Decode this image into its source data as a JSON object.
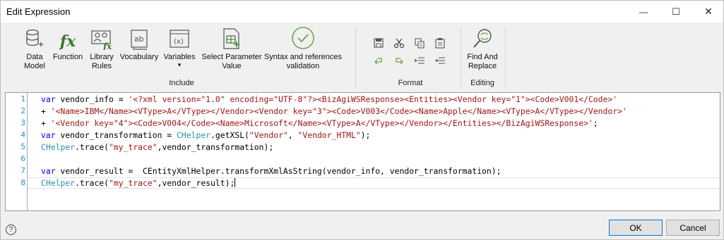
{
  "window": {
    "title": "Edit Expression",
    "minimize_glyph": "—",
    "maximize_glyph": "☐",
    "close_glyph": "✕"
  },
  "ribbon": {
    "include": {
      "label": "Include",
      "tools": [
        {
          "name": "data-model",
          "label": "Data\nModel",
          "icon": "database-add-icon"
        },
        {
          "name": "function",
          "label": "Function",
          "icon": "fx-icon",
          "glyph": "fx"
        },
        {
          "name": "library-rules",
          "label": "Library\nRules",
          "icon": "library-rules-icon"
        },
        {
          "name": "vocabulary",
          "label": "Vocabulary",
          "icon": "vocabulary-book-icon",
          "glyph": "ab"
        },
        {
          "name": "variables",
          "label": "Variables",
          "icon": "variables-icon",
          "glyph": "(x)",
          "dropdown": "▾"
        },
        {
          "name": "select-parameter-value",
          "label": "Select Parameter\nValue",
          "icon": "parameter-table-icon"
        },
        {
          "name": "syntax-validation",
          "label": "Syntax and references\nvalidation",
          "icon": "check-circle-icon"
        }
      ]
    },
    "format": {
      "label": "Format",
      "tools": [
        {
          "name": "save",
          "icon": "save-icon"
        },
        {
          "name": "cut",
          "icon": "cut-icon"
        },
        {
          "name": "copy",
          "icon": "copy-icon"
        },
        {
          "name": "paste",
          "icon": "paste-icon"
        },
        {
          "name": "undo",
          "icon": "undo-icon"
        },
        {
          "name": "redo",
          "icon": "redo-icon"
        },
        {
          "name": "outdent",
          "icon": "outdent-icon"
        },
        {
          "name": "indent",
          "icon": "indent-icon"
        }
      ]
    },
    "editing": {
      "label": "Editing",
      "tools": [
        {
          "name": "find-replace",
          "label": "Find And\nReplace",
          "icon": "find-replace-icon"
        }
      ]
    }
  },
  "editor": {
    "lines": [
      {
        "num": "1",
        "parts": [
          [
            "kw",
            "var"
          ],
          [
            "pl",
            " vendor_info = "
          ],
          [
            "str",
            "'<?xml version=\"1.0\" encoding=\"UTF-8\"?><BizAgiWSResponse><Entities><Vendor key=\"1\"><Code>V001</Code>'"
          ]
        ]
      },
      {
        "num": "2",
        "parts": [
          [
            "pl",
            "+ "
          ],
          [
            "str",
            "'<Name>IBM</Name><VType>A</VType></Vendor><Vendor key=\"3\"><Code>V003</Code><Name>Apple</Name><VType>A</VType></Vendor>'"
          ]
        ]
      },
      {
        "num": "3",
        "parts": [
          [
            "pl",
            "+ "
          ],
          [
            "str",
            "'<Vendor key=\"4\"><Code>V004</Code><Name>Microsoft</Name><VType>A</VType></Vendor></Entities></BizAgiWSResponse>'"
          ],
          [
            "pl",
            ";"
          ]
        ]
      },
      {
        "num": "4",
        "parts": [
          [
            "kw",
            "var"
          ],
          [
            "pl",
            " vendor_transformation = "
          ],
          [
            "cls",
            "CHelper"
          ],
          [
            "pl",
            ".getXSL("
          ],
          [
            "str",
            "\"Vendor\""
          ],
          [
            "pl",
            ", "
          ],
          [
            "str",
            "\"Vendor_HTML\""
          ],
          [
            "pl",
            ");"
          ]
        ]
      },
      {
        "num": "5",
        "parts": [
          [
            "cls",
            "CHelper"
          ],
          [
            "pl",
            ".trace("
          ],
          [
            "str",
            "\"my_trace\""
          ],
          [
            "pl",
            ",vendor_transformation);"
          ]
        ]
      },
      {
        "num": "6",
        "parts": []
      },
      {
        "num": "7",
        "parts": [
          [
            "kw",
            "var"
          ],
          [
            "pl",
            " vendor_result =  CEntityXmlHelper.transformXmlAsString(vendor_info, vendor_transformation);"
          ]
        ]
      },
      {
        "num": "8",
        "parts": [
          [
            "cls",
            "CHelper"
          ],
          [
            "pl",
            ".trace("
          ],
          [
            "str",
            "\"my_trace\""
          ],
          [
            "pl",
            ",vendor_result);"
          ]
        ]
      }
    ]
  },
  "footer": {
    "help_glyph": "?",
    "ok_label": "OK",
    "cancel_label": "Cancel"
  }
}
